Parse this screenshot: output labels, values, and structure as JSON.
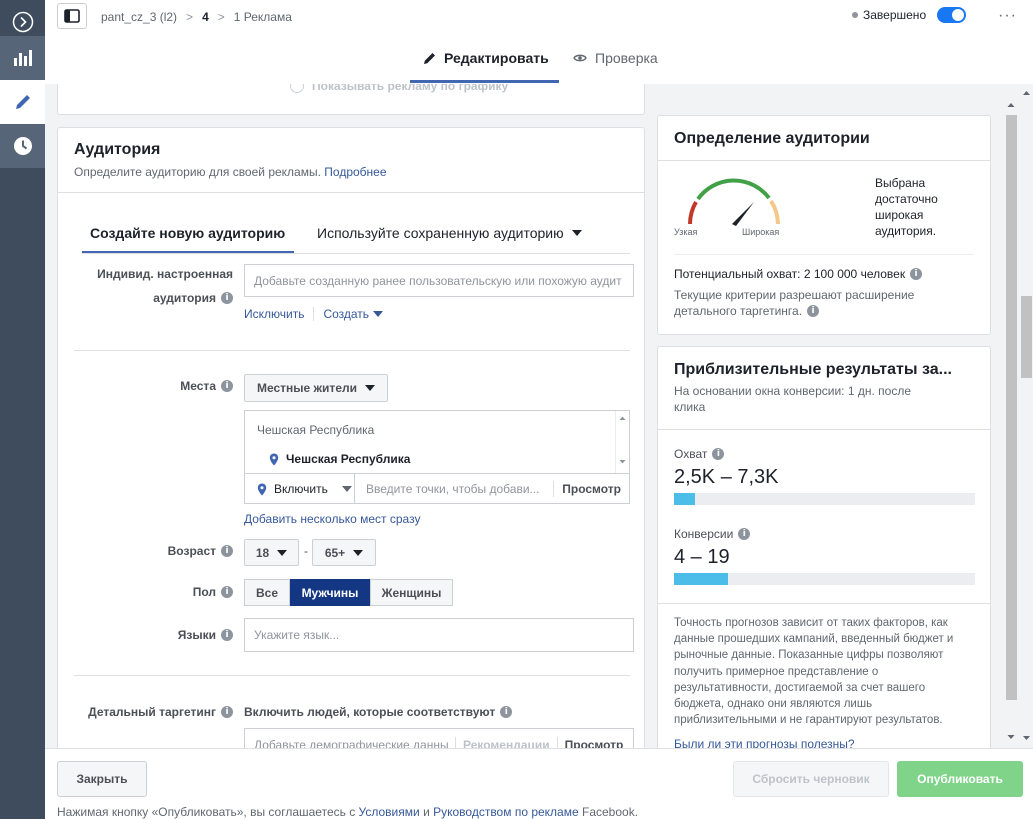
{
  "topbar": {
    "breadcrumbs": [
      "pant_cz_3 (l2)",
      "4",
      "1 Реклама"
    ],
    "status_label": "Завершено",
    "more_label": "···"
  },
  "mode_tabs": {
    "edit": "Редактировать",
    "review": "Проверка"
  },
  "prev_section": {
    "schedule_option": "Показывать рекламу по графику"
  },
  "audience": {
    "title": "Аудитория",
    "subtitle": "Определите аудиторию для своей рекламы.",
    "learn_more": "Подробнее",
    "tab_new": "Создайте новую аудиторию",
    "tab_saved": "Используйте сохраненную аудиторию",
    "custom_label_1": "Индивид. настроенная",
    "custom_label_2": "аудитория",
    "custom_placeholder": "Добавьте созданную ранее пользовательскую или похожую аудит",
    "exclude": "Исключить",
    "create": "Создать",
    "locations_label": "Места",
    "locations_type": "Местные жители",
    "country_header": "Чешская Республика",
    "selected_location": "Чешская Республика",
    "include": "Включить",
    "location_placeholder": "Введите точки, чтобы добави...",
    "browse": "Просмотр",
    "add_bulk": "Добавить несколько мест сразу",
    "age_label": "Возраст",
    "age_min": "18",
    "age_sep": "-",
    "age_max": "65+",
    "gender_label": "Пол",
    "gender_options": [
      "Все",
      "Мужчины",
      "Женщины"
    ],
    "gender_selected": "Мужчины",
    "languages_label": "Языки",
    "languages_placeholder": "Укажите язык...",
    "detailed_label": "Детальный таргетинг",
    "detailed_hint": "Включить людей, которые соответствуют",
    "detailed_placeholder": "Добавьте демографические данны",
    "recommendations": "Рекомендации",
    "detailed_browse": "Просмотр"
  },
  "definition": {
    "title": "Определение аудитории",
    "gauge_narrow": "Узкая",
    "gauge_wide": "Широкая",
    "verdict": [
      "Выбрана",
      "достаточно",
      "широкая",
      "аудитория."
    ],
    "potential_reach": "Потенциальный охват: 2 100 000 человек",
    "criteria_note_1": "Текущие критерии разрешают расширение",
    "criteria_note_2": "детального таргетинга."
  },
  "results": {
    "title": "Приблизительные результаты за...",
    "subtitle_1": "На основании окна конверсии: 1 дн. после",
    "subtitle_2": "клика",
    "reach_label": "Охват",
    "reach_value": "2,5K – 7,3K",
    "reach_fill": 0.07,
    "conv_label": "Конверсии",
    "conv_value": "4 – 19",
    "conv_fill": 0.18,
    "disclaimer": [
      "Точность прогнозов зависит от таких факторов, как",
      "данные прошедших кампаний, введенный бюджет и",
      "рыночные данные. Показанные цифры позволяют",
      "получить примерное представление о",
      "результативности, достигаемой за счет вашего",
      "бюджета, однако они являются лишь",
      "приблизительными и не гарантируют результатов."
    ],
    "feedback": "Были ли эти прогнозы полезны?"
  },
  "footer": {
    "close": "Закрыть",
    "discard": "Сбросить черновик",
    "publish": "Опубликовать",
    "note_prefix": "Нажимая кнопку «Опубликовать», вы соглашаетесь с",
    "note_terms": "Условиями",
    "note_and": "и",
    "note_guidelines": "Руководством по рекламе",
    "note_suffix": "Facebook."
  },
  "colors": {
    "accent": "#4267b2",
    "selected": "#133783",
    "publish": "#7fd489",
    "bar": "#4cbce8",
    "rail": "#3e4c5e"
  }
}
